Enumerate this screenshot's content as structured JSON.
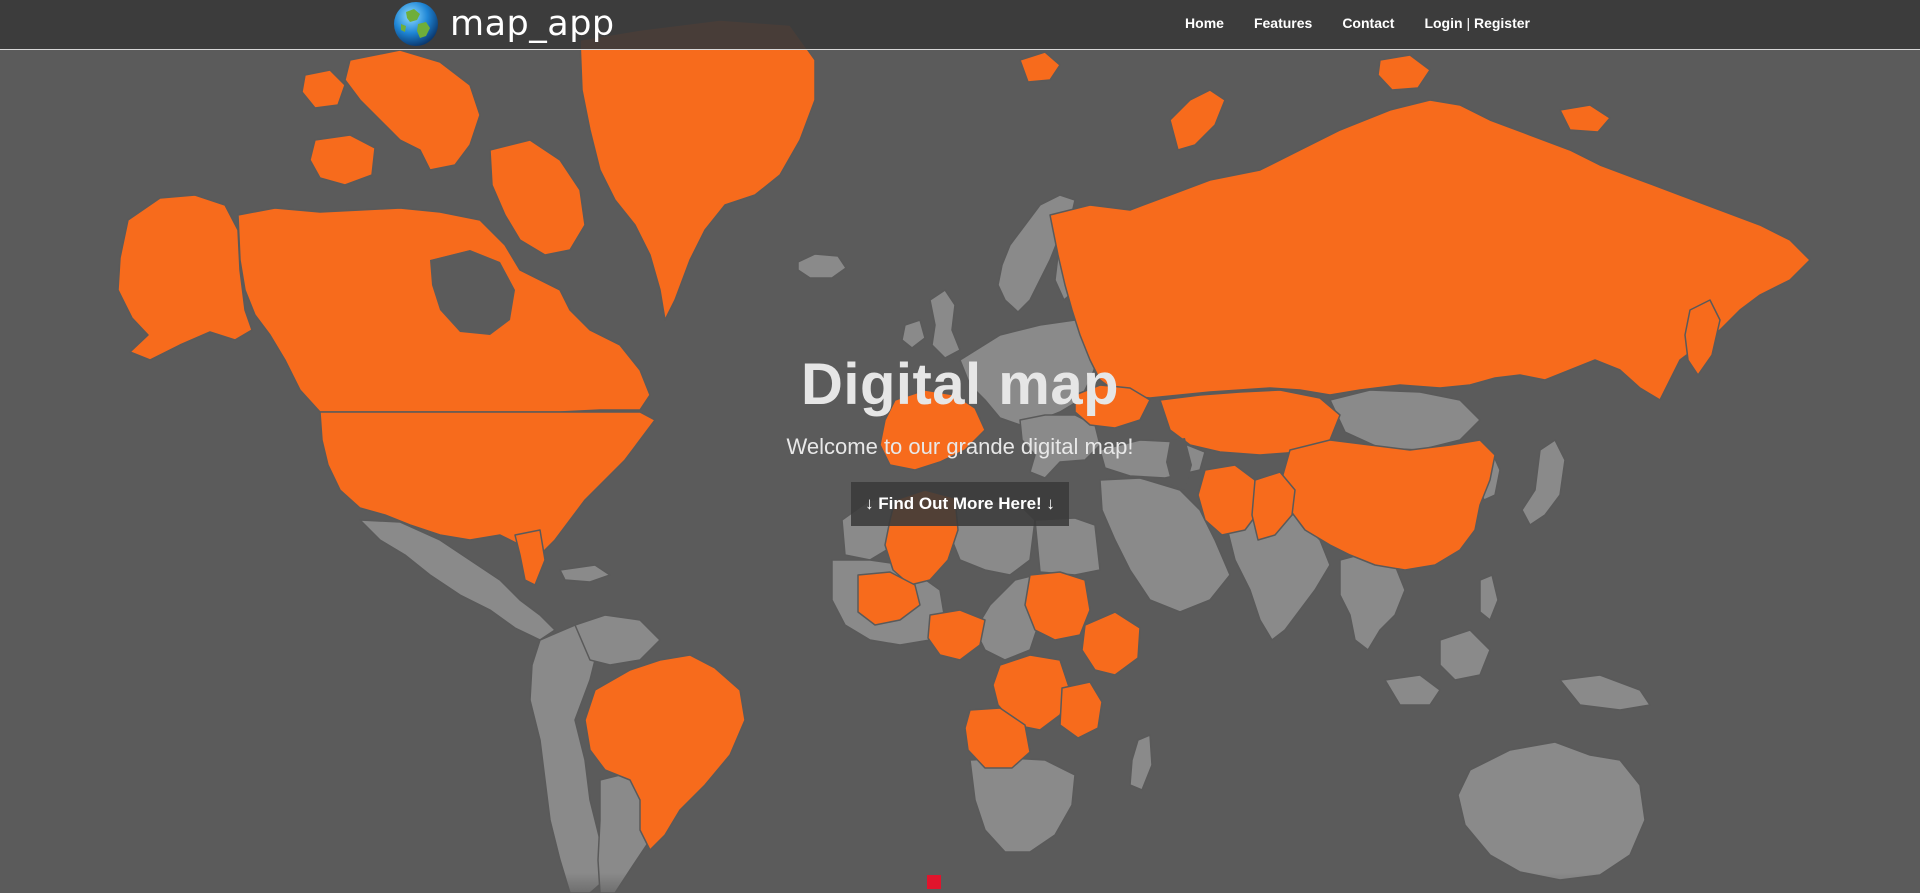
{
  "navbar": {
    "brand": "map_app",
    "links": {
      "home": "Home",
      "features": "Features",
      "contact": "Contact",
      "login": "Login",
      "separator": "|",
      "register": "Register"
    }
  },
  "hero": {
    "title": "Digital map",
    "subtitle": "Welcome to our grande digital map!",
    "button_label": "↓ Find Out More Here! ↓"
  },
  "colors": {
    "background": "#5b5b5b",
    "highlighted_country": "#f76b1c",
    "other_country": "#8a8a8a",
    "navbar": "#3a3a3a",
    "scroll_marker": "#e0142c"
  },
  "icons": {
    "brand": "globe-icon"
  }
}
